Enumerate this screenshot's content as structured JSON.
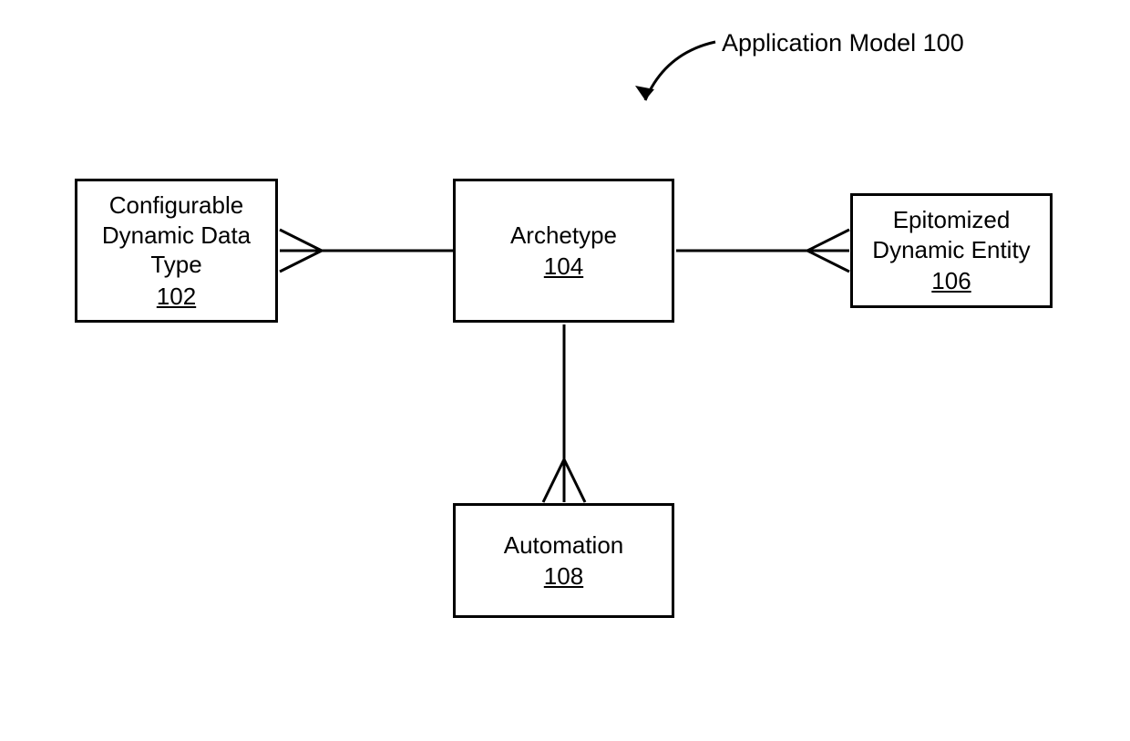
{
  "title": {
    "label": "Application Model",
    "ref": "100"
  },
  "boxes": {
    "configurable": {
      "line1": "Configurable",
      "line2": "Dynamic Data",
      "line3": "Type",
      "ref": "102"
    },
    "archetype": {
      "line1": "Archetype",
      "ref": "104"
    },
    "epitomized": {
      "line1": "Epitomized",
      "line2": "Dynamic Entity",
      "ref": "106"
    },
    "automation": {
      "line1": "Automation",
      "ref": "108"
    }
  }
}
